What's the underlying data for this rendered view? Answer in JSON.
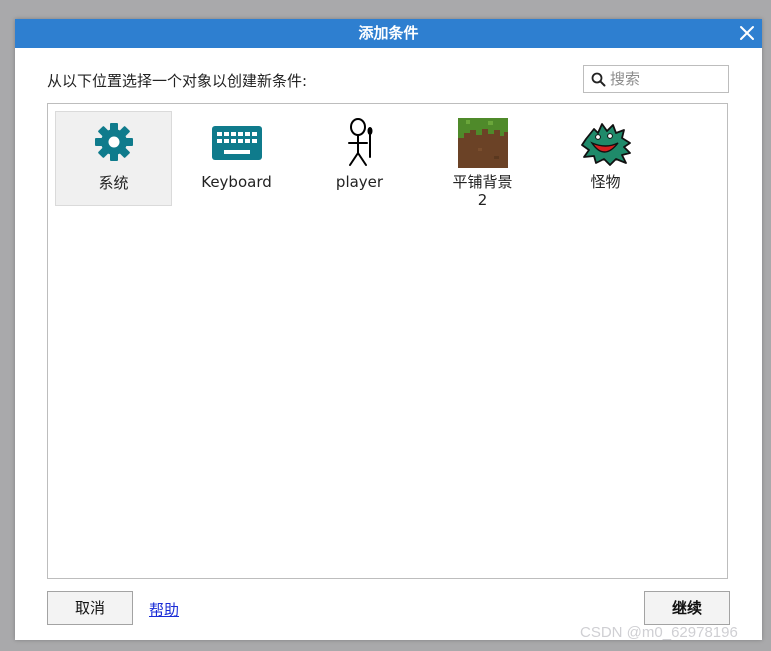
{
  "dialog": {
    "title": "添加条件",
    "prompt": "从以下位置选择一个对象以创建新条件:",
    "search": {
      "placeholder": "搜索",
      "value": ""
    },
    "objects": [
      {
        "label": "系统",
        "icon": "gear-icon",
        "selected": true
      },
      {
        "label": "Keyboard",
        "icon": "keyboard-icon",
        "selected": false
      },
      {
        "label": "player",
        "icon": "stick-figure-icon",
        "selected": false
      },
      {
        "label": "平铺背景 2",
        "icon": "grass-tile-icon",
        "selected": false
      },
      {
        "label": "怪物",
        "icon": "monster-icon",
        "selected": false
      }
    ],
    "buttons": {
      "cancel": "取消",
      "help": "帮助",
      "continue": "继续"
    }
  },
  "watermark": "CSDN @m0_62978196",
  "colors": {
    "titlebar": "#2e7fd0",
    "icon_teal": "#0f7b8c",
    "link": "#1a2cd6"
  }
}
